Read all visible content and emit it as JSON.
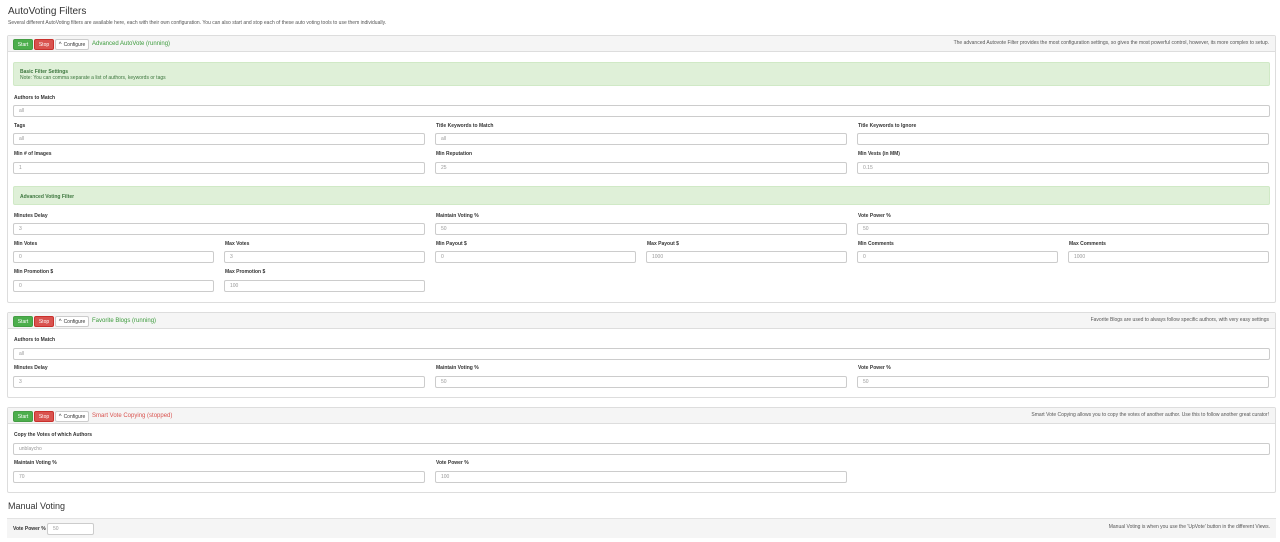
{
  "page": {
    "title": "AutoVoting Filters",
    "subtitle": "Several different AutoVoting filters are available here, each with their own configuration. You can also start and stop each of these auto voting tools to use them individually."
  },
  "buttons": {
    "start": "Start",
    "stop": "Stop",
    "configure": "Configure"
  },
  "advanced": {
    "name": "Advanced AutoVote (running)",
    "desc": "The advanced Autovote Filter provides the most configuration settings, so gives the most powerful control, however, its more complex to setup.",
    "basic_header": "Basic Filter Settings",
    "basic_sub": "Note: You can comma separate a list of authors, keywords or tags",
    "authors_label": "Authors to Match",
    "authors_value": "all",
    "tags_label": "Tags",
    "tags_value": "all",
    "title_kw_label": "Title Keywords to Match",
    "title_kw_value": "all",
    "title_ignore_label": "Title Keywords to Ignore",
    "title_ignore_value": "",
    "min_images_label": "Min # of Images",
    "min_images_value": "1",
    "min_rep_label": "Min Reputation",
    "min_rep_value": "25",
    "min_vests_label": "Min Vests (in MM)",
    "min_vests_value": "0.15",
    "adv_header": "Advanced Voting Filter",
    "minutes_delay_label": "Minutes Delay",
    "minutes_delay_value": "3",
    "maintain_label": "Maintain Voting %",
    "maintain_value": "50",
    "vote_power_label": "Vote Power %",
    "vote_power_value": "50",
    "min_votes_label": "Min Votes",
    "min_votes_value": "0",
    "max_votes_label": "Max Votes",
    "max_votes_value": "3",
    "min_payout_label": "Min Payout $",
    "min_payout_value": "0",
    "max_payout_label": "Max Payout $",
    "max_payout_value": "1000",
    "min_comments_label": "Min Comments",
    "min_comments_value": "0",
    "max_comments_label": "Max Comments",
    "max_comments_value": "1000",
    "min_promo_label": "Min Promotion $",
    "min_promo_value": "0",
    "max_promo_label": "Max Promotion $",
    "max_promo_value": "100"
  },
  "favorite": {
    "name": "Favorite Blogs (running)",
    "desc": "Favorite Blogs are used to always follow specific authors, with very easy settings",
    "authors_label": "Authors to Match",
    "authors_value": "all",
    "minutes_delay_label": "Minutes Delay",
    "minutes_delay_value": "3",
    "maintain_label": "Maintain Voting %",
    "maintain_value": "50",
    "vote_power_label": "Vote Power %",
    "vote_power_value": "50"
  },
  "smart": {
    "name": "Smart Vote Copying (stopped)",
    "desc": "Smart Vote Copying allows you to copy the votes of another author. Use this to follow another great curator!",
    "copy_label": "Copy the Votes of which Authors",
    "copy_value": "unblaycho",
    "maintain_label": "Maintain Voting %",
    "maintain_value": "70",
    "vote_power_label": "Vote Power %",
    "vote_power_value": "100"
  },
  "manual": {
    "title": "Manual Voting",
    "vote_power_label": "Vote Power %",
    "vote_power_value": "50",
    "desc": "Manual Voting is when you use the 'UpVote' button in the different Views."
  },
  "colors": {
    "start": "#4cae4c",
    "stop": "#d9534f",
    "alert_bg": "#dff0d8",
    "running": "#3c9b3c"
  }
}
